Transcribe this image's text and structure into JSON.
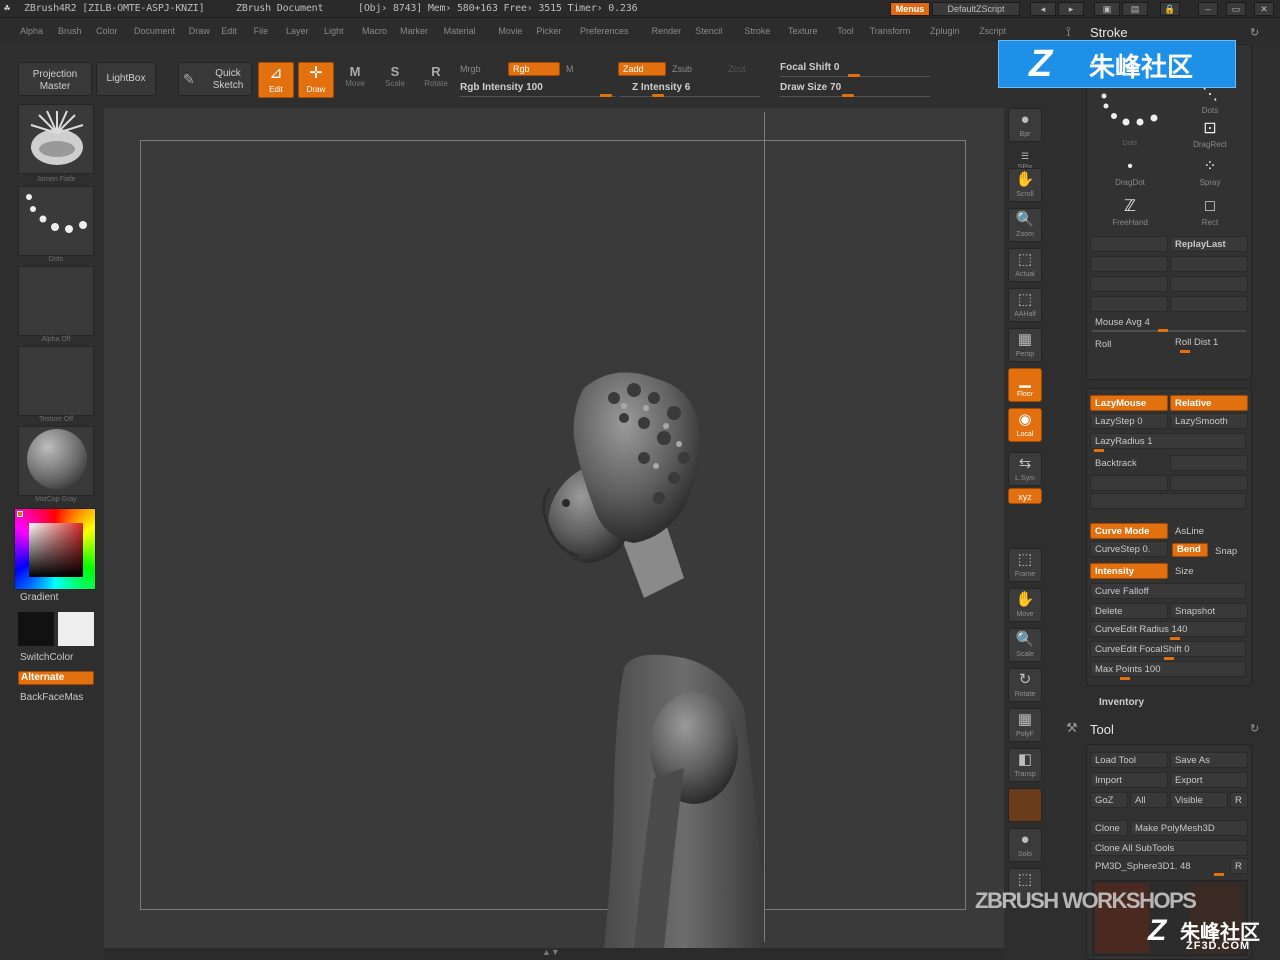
{
  "titlebar": {
    "app": "ZBrush4R2 [ZILB-OMTE-ASPJ-KNZI]",
    "document": "ZBrush Document",
    "stats": "[Obj› 8743] Mem› 580+163 Free› 3515 Timer› 0.236",
    "menus_btn": "Menus",
    "script_btn": "DefaultZScript"
  },
  "menubar": [
    "Alpha",
    "Brush",
    "Color",
    "Document",
    "Draw",
    "Edit",
    "File",
    "Layer",
    "Light",
    "Macro",
    "Marker",
    "Material",
    "Movie",
    "Picker",
    "Preferences",
    "Render",
    "Stencil",
    "Stroke",
    "Texture",
    "Tool",
    "Transform",
    "Zplugin",
    "Zscript"
  ],
  "shelf": {
    "projection_master": "Projection Master",
    "lightbox": "LightBox",
    "quick_sketch": "Quick Sketch",
    "edit": "Edit",
    "draw": "Draw",
    "move": "Move",
    "scale": "Scale",
    "rotate": "Rotate",
    "mrgb": "Mrgb",
    "rgb": "Rgb",
    "m": "M",
    "zadd": "Zadd",
    "zsub": "Zsub",
    "zcut": "Zcut",
    "rgb_intensity": "Rgb Intensity 100",
    "z_intensity": "Z Intensity 6",
    "focal_shift": "Focal Shift 0",
    "draw_size": "Draw Size 70"
  },
  "left": {
    "brush_caption": "Jaroen Fade",
    "stroke_caption": "Dots",
    "alpha_caption": "Alpha Off",
    "texture_caption": "Texture Off",
    "material_caption": "MatCap Gray",
    "gradient": "Gradient",
    "switchcolor": "SwitchColor",
    "alternate": "Alternate",
    "backfacemask": "BackFaceMas"
  },
  "rightshelf": [
    {
      "icon": "●",
      "label": "Bpr",
      "name": "bpr"
    },
    {
      "icon": "☰",
      "label": "SPix",
      "name": "spix"
    },
    {
      "icon": "✋",
      "label": "Scroll",
      "name": "scroll"
    },
    {
      "icon": "🔍",
      "label": "Zoom",
      "name": "zoom"
    },
    {
      "icon": "⬚",
      "label": "Actual",
      "name": "actual"
    },
    {
      "icon": "⬚",
      "label": "AAHalf",
      "name": "aahalf"
    },
    {
      "icon": "▦",
      "label": "Persp",
      "name": "persp"
    },
    {
      "icon": "▁",
      "label": "Floor",
      "name": "floor"
    },
    {
      "icon": "◉",
      "label": "Local",
      "name": "local"
    },
    {
      "icon": "⇆",
      "label": "L.Sym",
      "name": "lsym"
    },
    {
      "icon": "xyz",
      "label": "",
      "name": "xyz"
    },
    {
      "icon": "⬚",
      "label": "Frame",
      "name": "frame"
    },
    {
      "icon": "✋",
      "label": "Move",
      "name": "move"
    },
    {
      "icon": "🔍",
      "label": "Scale",
      "name": "scale"
    },
    {
      "icon": "↻",
      "label": "Rotate",
      "name": "rotate"
    },
    {
      "icon": "▦",
      "label": "PolyF",
      "name": "polyf"
    },
    {
      "icon": "◧",
      "label": "Transp",
      "name": "transp"
    },
    {
      "icon": "",
      "label": "",
      "name": "ghost"
    },
    {
      "icon": "●",
      "label": "Solo",
      "name": "solo"
    },
    {
      "icon": "⬚",
      "label": "",
      "name": "xpose"
    }
  ],
  "stroke_panel": {
    "title": "Stroke",
    "tiles": [
      {
        "icon": "⋰",
        "label": "Dots"
      },
      {
        "icon": "⋱",
        "label": "Dots"
      },
      {
        "icon": "•",
        "label": "DragDot"
      },
      {
        "icon": "⊡",
        "label": "DragRect"
      },
      {
        "icon": "ℤ",
        "label": "FreeHand"
      },
      {
        "icon": "⁘",
        "label": "Spray"
      },
      {
        "icon": "□",
        "label": "Rect"
      }
    ],
    "replaylast": "ReplayLast",
    "mouse_avg": "Mouse Avg 4",
    "roll": "Roll",
    "roll_dist": "Roll Dist 1",
    "lazymouse": "LazyMouse",
    "relative": "Relative",
    "lazystep": "LazyStep 0",
    "lazysmooth": "LazySmooth",
    "lazyradius": "LazyRadius 1",
    "backtrack": "Backtrack",
    "curve_mode": "Curve Mode",
    "asline": "AsLine",
    "curvestep": "CurveStep 0.",
    "bend": "Bend",
    "snap": "Snap",
    "intensity": "Intensity",
    "size": "Size",
    "curve_falloff": "Curve Falloff",
    "delete": "Delete",
    "snapshot": "Snapshot",
    "curveedit_radius": "CurveEdit Radius 140",
    "curveedit_focal": "CurveEdit FocalShift 0",
    "max_points": "Max Points 100",
    "inventory": "Inventory"
  },
  "tool_panel": {
    "title": "Tool",
    "load_tool": "Load Tool",
    "save_as": "Save As",
    "import": "Import",
    "export": "Export",
    "goz": "GoZ",
    "all": "All",
    "visible": "Visible",
    "r": "R",
    "clone": "Clone",
    "make_polymesh": "Make PolyMesh3D",
    "clone_all": "Clone All SubTools",
    "current_tool": "PM3D_Sphere3D1. 48"
  },
  "watermarks": {
    "logo_cn": "朱峰社区",
    "workshops": "ZBRUSH WORKSHOPS",
    "zf_cn": "朱峰社区",
    "zf_domain": "ZF3D.COM"
  },
  "colors": {
    "accent": "#e2700f",
    "bg": "#2e2e2e",
    "canvas": "#3a3a3a",
    "logo_blue": "#1e90e8"
  }
}
